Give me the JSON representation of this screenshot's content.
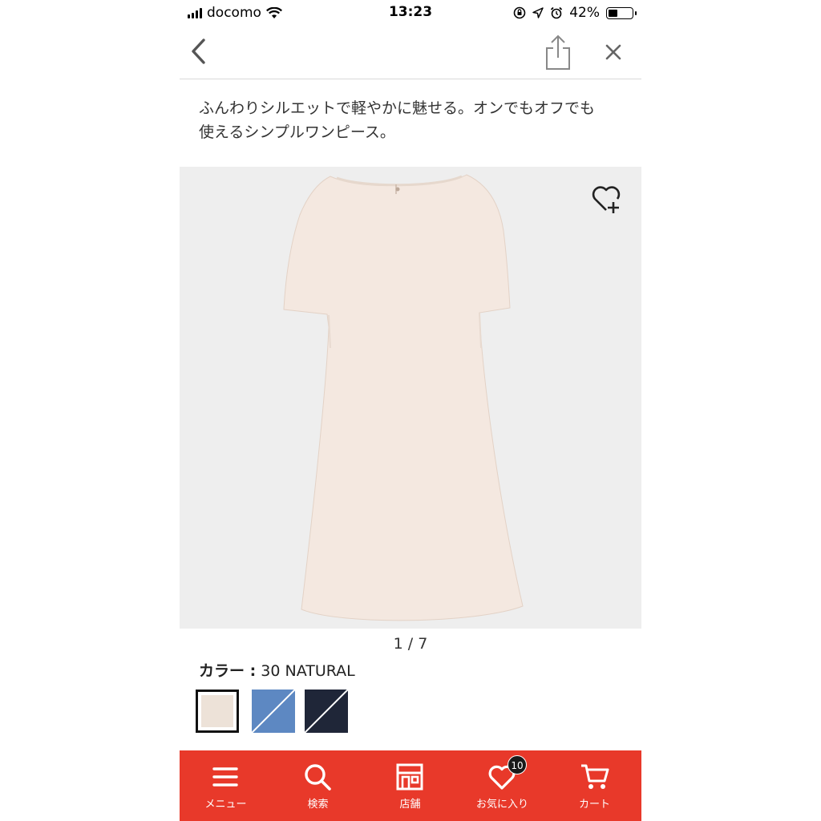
{
  "status_bar": {
    "carrier": "docomo",
    "time": "13:23",
    "battery": "42%",
    "battery_level": 0.42
  },
  "nav": {
    "back_icon": "chevron-left-icon",
    "share_icon": "share-icon",
    "close_icon": "close-icon"
  },
  "description": {
    "line1": "ふんわりシルエットで軽やかに魅せる。オンでもオフでも",
    "line2": "使えるシンプルワンピース。"
  },
  "product": {
    "favorite_icon": "heart-plus-icon",
    "pager": "1 / 7"
  },
  "color": {
    "label": "カラー :",
    "value": "30 NATURAL",
    "swatches": [
      {
        "name": "natural",
        "color": "#ede2d8",
        "selected": true
      },
      {
        "name": "blue",
        "color": "#5d88c2",
        "selected": false
      },
      {
        "name": "navy",
        "color": "#1f2638",
        "selected": false
      }
    ]
  },
  "tab_bar": {
    "background": "#e8392a",
    "items": [
      {
        "label": "メニュー",
        "icon": "menu-icon"
      },
      {
        "label": "検索",
        "icon": "search-icon"
      },
      {
        "label": "店舗",
        "icon": "store-icon"
      },
      {
        "label": "お気に入り",
        "icon": "heart-icon",
        "badge": "10"
      },
      {
        "label": "カート",
        "icon": "cart-icon"
      }
    ]
  }
}
